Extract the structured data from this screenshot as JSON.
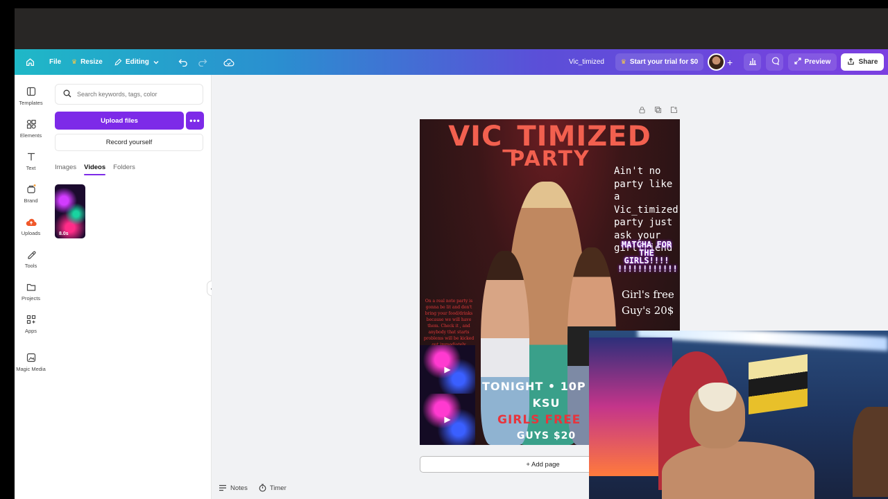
{
  "topbar": {
    "file": "File",
    "resize": "Resize",
    "editing": "Editing",
    "doc_title": "Vic_timized",
    "trial": "Start your trial for $0",
    "preview": "Preview",
    "share": "Share"
  },
  "rail": {
    "items": [
      {
        "label": "Templates",
        "icon": "templates-icon"
      },
      {
        "label": "Elements",
        "icon": "elements-icon"
      },
      {
        "label": "Text",
        "icon": "text-icon"
      },
      {
        "label": "Brand",
        "icon": "brand-icon"
      },
      {
        "label": "Uploads",
        "icon": "uploads-icon"
      },
      {
        "label": "Tools",
        "icon": "tools-icon"
      },
      {
        "label": "Projects",
        "icon": "projects-icon"
      },
      {
        "label": "Apps",
        "icon": "apps-icon"
      },
      {
        "label": "Magic Media",
        "icon": "magic-media-icon"
      }
    ]
  },
  "panel": {
    "search_placeholder": "Search keywords, tags, color",
    "upload": "Upload files",
    "record": "Record yourself",
    "tabs": [
      "Images",
      "Videos",
      "Folders"
    ],
    "active_tab": "Videos",
    "video_duration": "8.0s"
  },
  "design": {
    "title_line1": "VIC_TIMIZED",
    "title_line2": "PARTY",
    "quote": "Ain't no party like a Vic_timized party just ask your girlfriend",
    "matcha": "MATCHA FOR THE GIRLS!!!! !!!!!!!!!!!!",
    "girls_free": "Girl's free",
    "guys_price": "Guy's 20$",
    "small_text": "On a real note party is gonna be lit and don't bring your food/drinks because we will have them. Check it , and anybody that starts problems will be kicked out immediately",
    "tonight": "TONIGHT • 10P",
    "ksu": "KSU",
    "girls_free_caps": "GIRLS FREE",
    "guys_caps": "GUYS $20"
  },
  "canvas": {
    "add_page": "+ Add page",
    "notes": "Notes",
    "timer": "Timer"
  },
  "colors": {
    "accent": "#7d2ae8",
    "poster_red": "#f2604f"
  }
}
